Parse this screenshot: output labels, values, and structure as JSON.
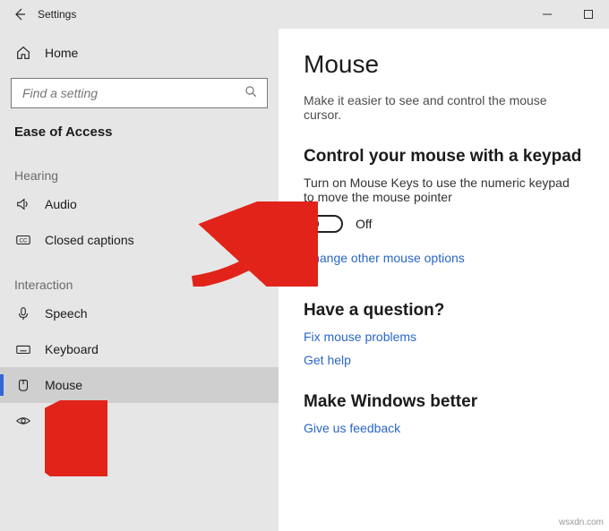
{
  "titlebar": {
    "title": "Settings"
  },
  "sidebar": {
    "home": "Home",
    "search_placeholder": "Find a setting",
    "category": "Ease of Access",
    "group_hearing": "Hearing",
    "audio": "Audio",
    "closed_captions": "Closed captions",
    "group_interaction": "Interaction",
    "speech": "Speech",
    "keyboard": "Keyboard",
    "mouse": "Mouse",
    "eye_control": "Eye control"
  },
  "content": {
    "page_title": "Mouse",
    "lead": "Make it easier to see and control the mouse cursor.",
    "section_control": "Control your mouse with a keypad",
    "control_desc": "Turn on Mouse Keys to use the numeric keypad to move the mouse pointer",
    "toggle_state": "Off",
    "change_other": "Change other mouse options",
    "question_h": "Have a question?",
    "link_fix": "Fix mouse problems",
    "link_help": "Get help",
    "better_h": "Make Windows better",
    "link_feedback": "Give us feedback"
  },
  "watermark": "wsxdn.com"
}
